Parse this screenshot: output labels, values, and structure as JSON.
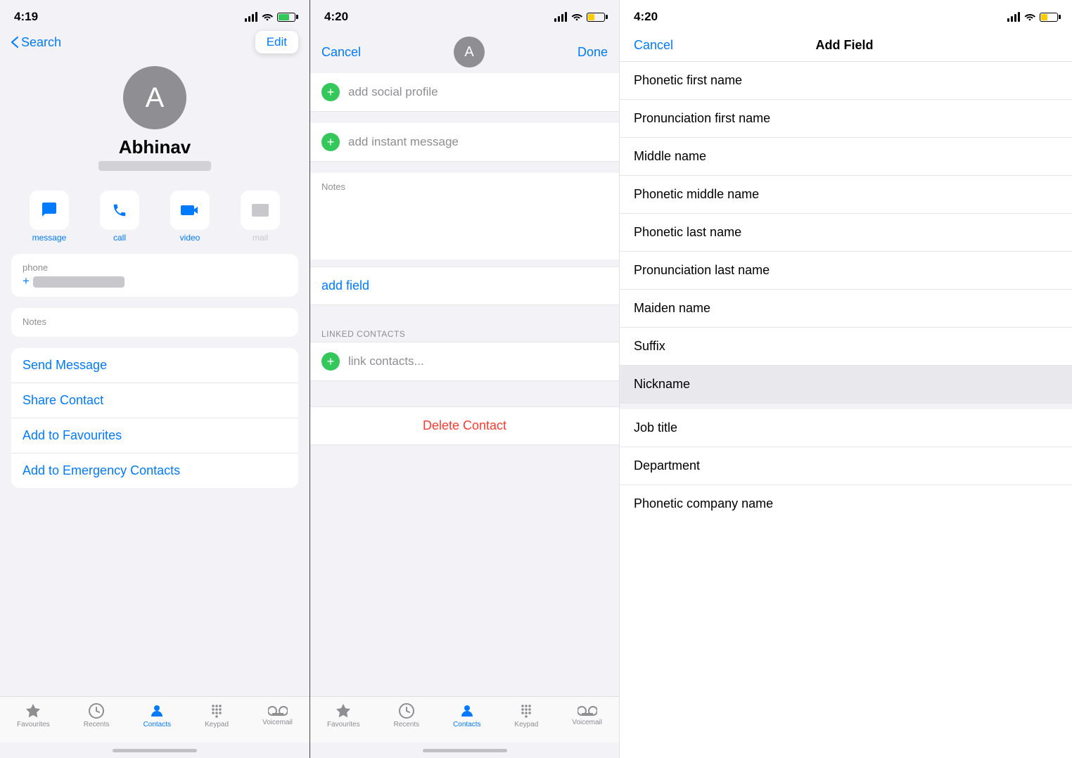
{
  "panel1": {
    "status": {
      "time": "4:19",
      "signal": "signal",
      "wifi": "wifi",
      "battery": "battery"
    },
    "nav": {
      "back_label": "Search",
      "edit_label": "Edit"
    },
    "contact": {
      "avatar_letter": "A",
      "name": "Abhinav",
      "subtitle": ""
    },
    "actions": [
      {
        "id": "message",
        "label": "message",
        "active": true
      },
      {
        "id": "call",
        "label": "call",
        "active": true
      },
      {
        "id": "video",
        "label": "video",
        "active": true
      },
      {
        "id": "mail",
        "label": "mail",
        "active": false
      }
    ],
    "phone_label": "phone",
    "notes_label": "Notes",
    "links": [
      {
        "id": "send-message",
        "label": "Send Message"
      },
      {
        "id": "share-contact",
        "label": "Share Contact"
      },
      {
        "id": "add-favourites",
        "label": "Add to Favourites"
      },
      {
        "id": "add-emergency",
        "label": "Add to Emergency Contacts"
      }
    ],
    "tabs": [
      {
        "id": "favourites",
        "label": "Favourites"
      },
      {
        "id": "recents",
        "label": "Recents"
      },
      {
        "id": "contacts",
        "label": "Contacts",
        "active": true
      },
      {
        "id": "keypad",
        "label": "Keypad"
      },
      {
        "id": "voicemail",
        "label": "Voicemail"
      }
    ]
  },
  "panel2": {
    "status": {
      "time": "4:20"
    },
    "nav": {
      "cancel_label": "Cancel",
      "done_label": "Done",
      "avatar_letter": "A"
    },
    "add_items": [
      {
        "id": "add-social",
        "label": "add social profile"
      },
      {
        "id": "add-instant",
        "label": "add instant message"
      }
    ],
    "notes_label": "Notes",
    "add_field_label": "add field",
    "linked_header": "LINKED CONTACTS",
    "link_contacts_label": "link contacts...",
    "delete_label": "Delete Contact",
    "tabs": [
      {
        "id": "favourites",
        "label": "Favourites"
      },
      {
        "id": "recents",
        "label": "Recents"
      },
      {
        "id": "contacts",
        "label": "Contacts",
        "active": true
      },
      {
        "id": "keypad",
        "label": "Keypad"
      },
      {
        "id": "voicemail",
        "label": "Voicemail"
      }
    ]
  },
  "panel3": {
    "status": {
      "time": "4:20"
    },
    "nav": {
      "cancel_label": "Cancel",
      "title": "Add Field"
    },
    "fields": [
      {
        "id": "phonetic-first",
        "label": "Phonetic first name",
        "highlighted": false
      },
      {
        "id": "pronunciation-first",
        "label": "Pronunciation first name",
        "highlighted": false
      },
      {
        "id": "middle-name",
        "label": "Middle name",
        "highlighted": false
      },
      {
        "id": "phonetic-middle",
        "label": "Phonetic middle name",
        "highlighted": false
      },
      {
        "id": "phonetic-last",
        "label": "Phonetic last name",
        "highlighted": false
      },
      {
        "id": "pronunciation-last",
        "label": "Pronunciation last name",
        "highlighted": false
      },
      {
        "id": "maiden-name",
        "label": "Maiden name",
        "highlighted": false
      },
      {
        "id": "suffix",
        "label": "Suffix",
        "highlighted": false
      },
      {
        "id": "nickname",
        "label": "Nickname",
        "highlighted": true
      },
      {
        "id": "job-title",
        "label": "Job title",
        "highlighted": false
      },
      {
        "id": "department",
        "label": "Department",
        "highlighted": false
      },
      {
        "id": "phonetic-company",
        "label": "Phonetic company name",
        "highlighted": false
      }
    ]
  }
}
